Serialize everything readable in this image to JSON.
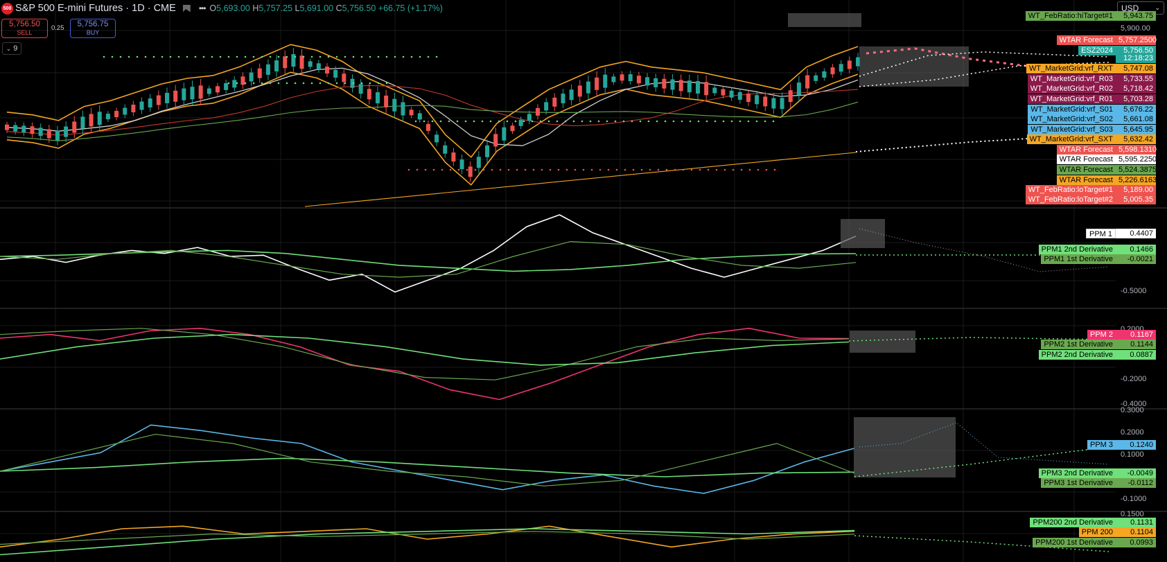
{
  "header": {
    "logo_text": "500",
    "title": "S&P 500 E-mini Futures · 1D · CME",
    "open_label": "O",
    "open": "5,693.00",
    "high_label": "H",
    "high": "5,757.25",
    "low_label": "L",
    "low": "5,691.00",
    "close_label": "C",
    "close": "5,756.50",
    "change": "+66.75 (+1.17%)"
  },
  "trading": {
    "sell_price": "5,756.50",
    "sell_label": "SELL",
    "buy_price": "5,756.75",
    "buy_label": "BUY",
    "spread": "0.25",
    "indicators_count": "9"
  },
  "currency": "USD",
  "axis_ticks": [
    "5,900.00",
    "-0.5000",
    "0.2000",
    "-0.2000",
    "-0.4000",
    "0.3000",
    "0.2000",
    "0.1000",
    "-0.1000",
    "0.1500"
  ],
  "price_labels": [
    {
      "name": "WT_FebRatio:hiTarget#1",
      "value": "5,943.75"
    },
    {
      "name": "WTAR Forecast",
      "value": "5,757.2500"
    },
    {
      "name": "ESZ2024",
      "value": "5,756.50"
    },
    {
      "name": "",
      "value": "12:18:23"
    },
    {
      "name": "WT_MarketGrid:vrf_RXT",
      "value": "5,747.08"
    },
    {
      "name": "WT_MarketGrid:vrf_R03",
      "value": "5,733.55"
    },
    {
      "name": "WT_MarketGrid:vrf_R02",
      "value": "5,718.42"
    },
    {
      "name": "WT_MarketGrid:vrf_R01",
      "value": "5,703.28"
    },
    {
      "name": "WT_MarketGrid:vrf_S01",
      "value": "5,676.22"
    },
    {
      "name": "WT_MarketGrid:vrf_S02",
      "value": "5,661.08"
    },
    {
      "name": "WT_MarketGrid:vrf_S03",
      "value": "5,645.95"
    },
    {
      "name": "WT_MarketGrid:vrf_SXT",
      "value": "5,632.42"
    },
    {
      "name": "WTAR Forecast",
      "value": "5,598.1310"
    },
    {
      "name": "WTAR Forecast",
      "value": "5,595.2250"
    },
    {
      "name": "WTAR Forecast",
      "value": "5,524.3875"
    },
    {
      "name": "WTAR Forecast",
      "value": "5,226.6163"
    },
    {
      "name": "WT_FebRatio:loTarget#1",
      "value": "5,189.00"
    },
    {
      "name": "WT_FebRatio:loTarget#2",
      "value": "5,005.35"
    }
  ],
  "osc_labels": [
    {
      "name": "PPM 1",
      "value": "0.4407"
    },
    {
      "name": "PPM1 2nd Derivative",
      "value": "0.1466"
    },
    {
      "name": "PPM1 1st Derivative",
      "value": "-0.0021"
    },
    {
      "name": "PPM 2",
      "value": "0.1167"
    },
    {
      "name": "PPM2 1st Derivative",
      "value": "0.1144"
    },
    {
      "name": "PPM2 2nd Derivative",
      "value": "0.0887"
    },
    {
      "name": "PPM 3",
      "value": "0.1240"
    },
    {
      "name": "PPM3 2nd Derivative",
      "value": "-0.0049"
    },
    {
      "name": "PPM3 1st Derivative",
      "value": "-0.0112"
    },
    {
      "name": "PPM200 2nd Derivative",
      "value": "0.1131"
    },
    {
      "name": "PPM 200",
      "value": "0.1104"
    },
    {
      "name": "PPM200 1st Derivative",
      "value": "0.0993"
    }
  ],
  "colors": {
    "up": "#26a69a",
    "down": "#ef5350",
    "envelope": "#f5a623",
    "ma_white": "#cfcfcf",
    "ma_red": "#c0392b",
    "ma_green": "#6aa84f",
    "trend": "#f5a623",
    "ppm1": "#ffffff",
    "ppm2": "#f0346e",
    "ppm3": "#5ab8e8",
    "ppm200": "#f5a623",
    "deriv1": "#6aa84f",
    "deriv2": "#6fe07a",
    "grid": "#1a1a1a"
  },
  "chart_data": [
    {
      "type": "line",
      "series": [
        {
          "name": "ESZ2024",
          "values": [
            5640,
            5635,
            5625,
            5650,
            5660,
            5675,
            5690,
            5700,
            5705,
            5720,
            5740,
            5760,
            5750,
            5730,
            5700,
            5680,
            5660,
            5600,
            5560,
            5620,
            5650,
            5680,
            5700,
            5720,
            5730,
            5720,
            5715,
            5710,
            5700,
            5690,
            5680,
            5720,
            5740,
            5756.5
          ]
        }
      ]
    },
    {
      "type": "line",
      "series": [
        {
          "name": "PPM 1",
          "values": [
            0.05,
            0.1,
            0.0,
            0.12,
            0.2,
            0.15,
            0.25,
            0.1,
            0.12,
            -0.1,
            -0.3,
            -0.2,
            -0.5,
            -0.3,
            -0.1,
            0.2,
            0.6,
            0.8,
            0.5,
            0.3,
            0.1,
            -0.1,
            -0.25,
            -0.1,
            0.05,
            0.2,
            0.4407
          ]
        },
        {
          "name": "PPM1 2nd Derivative",
          "values": [
            0.1,
            0.12,
            0.15,
            0.18,
            0.2,
            0.15,
            0.05,
            -0.05,
            -0.1,
            -0.15,
            -0.12,
            -0.05,
            0.05,
            0.1,
            0.14,
            0.1466
          ]
        },
        {
          "name": "PPM1 1st Derivative",
          "values": [
            0.1,
            0.05,
            0.15,
            0.2,
            0.1,
            -0.05,
            -0.2,
            -0.25,
            -0.2,
            0.1,
            0.35,
            0.3,
            0.1,
            -0.05,
            -0.1,
            -0.0021
          ]
        }
      ]
    },
    {
      "type": "line",
      "series": [
        {
          "name": "PPM 2",
          "values": [
            0.12,
            0.15,
            0.1,
            0.18,
            0.2,
            0.15,
            0.05,
            -0.1,
            -0.15,
            -0.3,
            -0.38,
            -0.25,
            -0.1,
            0.05,
            0.15,
            0.2,
            0.12,
            0.1167
          ]
        },
        {
          "name": "PPM2 1st Derivative",
          "values": [
            0.15,
            0.18,
            0.2,
            0.15,
            0.05,
            -0.1,
            -0.2,
            -0.22,
            -0.1,
            0.05,
            0.12,
            0.1,
            0.1144
          ]
        },
        {
          "name": "PPM2 2nd Derivative",
          "values": [
            -0.05,
            0.05,
            0.12,
            0.15,
            0.12,
            0.05,
            -0.05,
            -0.1,
            -0.08,
            0.0,
            0.06,
            0.0887
          ]
        }
      ]
    },
    {
      "type": "line",
      "series": [
        {
          "name": "PPM 3",
          "values": [
            0.0,
            0.05,
            0.1,
            0.25,
            0.22,
            0.18,
            0.15,
            0.05,
            0.0,
            -0.05,
            -0.1,
            -0.05,
            -0.02,
            -0.08,
            -0.12,
            -0.05,
            0.05,
            0.124
          ]
        },
        {
          "name": "PPM3 2nd Derivative",
          "values": [
            0.0,
            0.02,
            0.05,
            0.07,
            0.05,
            0.02,
            -0.01,
            -0.03,
            -0.01,
            -0.0049
          ]
        },
        {
          "name": "PPM3 1st Derivative",
          "values": [
            0.0,
            0.1,
            0.2,
            0.15,
            0.05,
            0.0,
            -0.03,
            -0.08,
            -0.05,
            0.05,
            0.15,
            -0.0112
          ]
        }
      ]
    },
    {
      "type": "line",
      "series": [
        {
          "name": "PPM 200",
          "values": [
            0.05,
            0.08,
            0.12,
            0.13,
            0.1,
            0.11,
            0.12,
            0.08,
            0.1,
            0.13,
            0.09,
            0.05,
            0.08,
            0.1,
            0.1104
          ]
        },
        {
          "name": "PPM200 2nd Derivative",
          "values": [
            0.02,
            0.05,
            0.08,
            0.1,
            0.11,
            0.12,
            0.11,
            0.1,
            0.1131
          ]
        },
        {
          "name": "PPM200 1st Derivative",
          "values": [
            0.06,
            0.08,
            0.1,
            0.09,
            0.1,
            0.11,
            0.1,
            0.08,
            0.0993
          ]
        }
      ]
    }
  ]
}
